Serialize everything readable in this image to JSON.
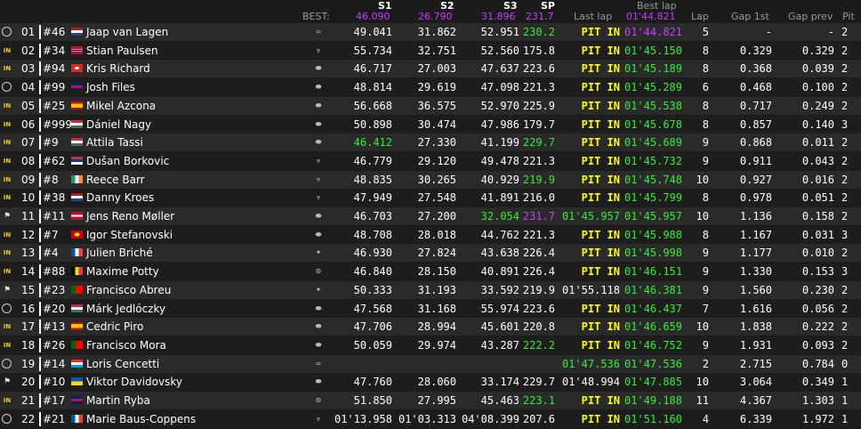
{
  "header": {
    "best_label": "BEST:",
    "col_s1": "S1",
    "col_s2": "S2",
    "col_s3": "S3",
    "col_sp": "SP",
    "col_last_lap": "Last lap",
    "col_best_lap": "Best lap",
    "col_lap": "Lap",
    "col_gap_1st": "Gap 1st",
    "col_gap_prev": "Gap prev",
    "col_pit": "Pit",
    "best_s1": "46.090",
    "best_s2": "26.790",
    "best_s3": "31.896",
    "best_sp": "231.7",
    "best_lap": "01'44.821"
  },
  "colors": {
    "personal_best": "#33ee33",
    "overall_best": "#c83cff",
    "pit": "#ffff00"
  },
  "rows": [
    {
      "status": "track",
      "pos": "01",
      "num": "#46",
      "flag": "nl",
      "name": "Jaap van Lagen",
      "brand": "audi",
      "s1": "49.041",
      "s2": "31.862",
      "s3": "52.951",
      "sp": "230.2",
      "last": "PIT IN",
      "best": "01'44.821",
      "lap": "5",
      "gap1": "-",
      "gapp": "-",
      "pit": "2",
      "c_s1": "",
      "c_s2": "",
      "c_s3": "",
      "c_sp": "green",
      "c_last": "yellow",
      "c_best": "purple"
    },
    {
      "status": "in",
      "pos": "02",
      "num": "#34",
      "flag": "no",
      "name": "Stian Paulsen",
      "brand": "cupra",
      "s1": "55.734",
      "s2": "32.751",
      "s3": "52.560",
      "sp": "175.8",
      "last": "PIT IN",
      "best": "01'45.150",
      "lap": "8",
      "gap1": "0.329",
      "gapp": "0.329",
      "pit": "2",
      "c_s1": "",
      "c_s2": "",
      "c_s3": "",
      "c_sp": "",
      "c_last": "yellow",
      "c_best": "green"
    },
    {
      "status": "in",
      "pos": "03",
      "num": "#94",
      "flag": "ch",
      "name": "Kris Richard",
      "brand": "hyundai",
      "s1": "46.717",
      "s2": "27.003",
      "s3": "47.637",
      "sp": "223.6",
      "last": "PIT IN",
      "best": "01'45.189",
      "lap": "8",
      "gap1": "0.368",
      "gapp": "0.039",
      "pit": "2",
      "c_s1": "",
      "c_s2": "",
      "c_s3": "",
      "c_sp": "",
      "c_last": "yellow",
      "c_best": "green"
    },
    {
      "status": "track",
      "pos": "04",
      "num": "#99",
      "flag": "gb",
      "name": "Josh Files",
      "brand": "hyundai",
      "s1": "48.814",
      "s2": "29.619",
      "s3": "47.098",
      "sp": "221.3",
      "last": "PIT IN",
      "best": "01'45.289",
      "lap": "6",
      "gap1": "0.468",
      "gapp": "0.100",
      "pit": "2",
      "c_s1": "",
      "c_s2": "",
      "c_s3": "",
      "c_sp": "",
      "c_last": "yellow",
      "c_best": "green"
    },
    {
      "status": "in",
      "pos": "05",
      "num": "#25",
      "flag": "es",
      "name": "Mikel Azcona",
      "brand": "hyundai",
      "s1": "56.668",
      "s2": "36.575",
      "s3": "52.970",
      "sp": "225.9",
      "last": "PIT IN",
      "best": "01'45.538",
      "lap": "8",
      "gap1": "0.717",
      "gapp": "0.249",
      "pit": "2",
      "c_s1": "",
      "c_s2": "",
      "c_s3": "",
      "c_sp": "",
      "c_last": "yellow",
      "c_best": "green"
    },
    {
      "status": "in",
      "pos": "06",
      "num": "#999",
      "flag": "hu",
      "name": "Dániel Nagy",
      "brand": "hyundai",
      "s1": "50.898",
      "s2": "30.474",
      "s3": "47.986",
      "sp": "179.7",
      "last": "PIT IN",
      "best": "01'45.678",
      "lap": "8",
      "gap1": "0.857",
      "gapp": "0.140",
      "pit": "3",
      "c_s1": "",
      "c_s2": "",
      "c_s3": "",
      "c_sp": "",
      "c_last": "yellow",
      "c_best": "green"
    },
    {
      "status": "in",
      "pos": "07",
      "num": "#9",
      "flag": "hu",
      "name": "Attila Tassi",
      "brand": "hyundai",
      "s1": "46.412",
      "s2": "27.330",
      "s3": "41.199",
      "sp": "229.7",
      "last": "PIT IN",
      "best": "01'45.689",
      "lap": "9",
      "gap1": "0.868",
      "gapp": "0.011",
      "pit": "2",
      "c_s1": "green",
      "c_s2": "",
      "c_s3": "",
      "c_sp": "green",
      "c_last": "yellow",
      "c_best": "green"
    },
    {
      "status": "in",
      "pos": "08",
      "num": "#62",
      "flag": "rs",
      "name": "Dušan Borkovic",
      "brand": "cupra",
      "s1": "46.779",
      "s2": "29.120",
      "s3": "49.478",
      "sp": "221.3",
      "last": "PIT IN",
      "best": "01'45.732",
      "lap": "9",
      "gap1": "0.911",
      "gapp": "0.043",
      "pit": "2",
      "c_s1": "",
      "c_s2": "",
      "c_s3": "",
      "c_sp": "",
      "c_last": "yellow",
      "c_best": "green"
    },
    {
      "status": "in",
      "pos": "09",
      "num": "#8",
      "flag": "ie",
      "name": "Reece Barr",
      "brand": "cupra",
      "s1": "48.835",
      "s2": "30.265",
      "s3": "40.929",
      "sp": "219.9",
      "last": "PIT IN",
      "best": "01'45.748",
      "lap": "10",
      "gap1": "0.927",
      "gapp": "0.016",
      "pit": "2",
      "c_s1": "",
      "c_s2": "",
      "c_s3": "",
      "c_sp": "green",
      "c_last": "yellow",
      "c_best": "green"
    },
    {
      "status": "in",
      "pos": "10",
      "num": "#38",
      "flag": "nl",
      "name": "Danny Kroes",
      "brand": "cupra",
      "s1": "47.949",
      "s2": "27.548",
      "s3": "41.891",
      "sp": "216.0",
      "last": "PIT IN",
      "best": "01'45.799",
      "lap": "8",
      "gap1": "0.978",
      "gapp": "0.051",
      "pit": "2",
      "c_s1": "",
      "c_s2": "",
      "c_s3": "",
      "c_sp": "",
      "c_last": "yellow",
      "c_best": "green"
    },
    {
      "status": "flag",
      "pos": "11",
      "num": "#11",
      "flag": "dk",
      "name": "Jens Reno Møller",
      "brand": "hyundai",
      "s1": "46.703",
      "s2": "27.200",
      "s3": "32.054",
      "sp": "231.7",
      "last": "01'45.957",
      "best": "01'45.957",
      "lap": "10",
      "gap1": "1.136",
      "gapp": "0.158",
      "pit": "2",
      "c_s1": "",
      "c_s2": "",
      "c_s3": "green",
      "c_sp": "purple",
      "c_last": "green",
      "c_best": "green"
    },
    {
      "status": "in",
      "pos": "12",
      "num": "#7",
      "flag": "mk",
      "name": "Igor Stefanovski",
      "brand": "hyundai",
      "s1": "48.708",
      "s2": "28.018",
      "s3": "44.762",
      "sp": "221.3",
      "last": "PIT IN",
      "best": "01'45.988",
      "lap": "8",
      "gap1": "1.167",
      "gapp": "0.031",
      "pit": "3",
      "c_s1": "",
      "c_s2": "",
      "c_s3": "",
      "c_sp": "",
      "c_last": "yellow",
      "c_best": "green"
    },
    {
      "status": "in",
      "pos": "13",
      "num": "#4",
      "flag": "fr",
      "name": "Julien Briché",
      "brand": "alfa",
      "s1": "46.930",
      "s2": "27.824",
      "s3": "43.638",
      "sp": "226.4",
      "last": "PIT IN",
      "best": "01'45.998",
      "lap": "9",
      "gap1": "1.177",
      "gapp": "0.010",
      "pit": "2",
      "c_s1": "",
      "c_s2": "",
      "c_s3": "",
      "c_sp": "",
      "c_last": "yellow",
      "c_best": "green"
    },
    {
      "status": "in",
      "pos": "14",
      "num": "#88",
      "flag": "be",
      "name": "Maxime Potty",
      "brand": "vw",
      "s1": "46.840",
      "s2": "28.150",
      "s3": "40.891",
      "sp": "226.4",
      "last": "PIT IN",
      "best": "01'46.151",
      "lap": "9",
      "gap1": "1.330",
      "gapp": "0.153",
      "pit": "3",
      "c_s1": "",
      "c_s2": "",
      "c_s3": "",
      "c_sp": "",
      "c_last": "yellow",
      "c_best": "green"
    },
    {
      "status": "flag",
      "pos": "15",
      "num": "#23",
      "flag": "pt",
      "name": "Francisco Abreu",
      "brand": "alfa",
      "s1": "50.333",
      "s2": "31.193",
      "s3": "33.592",
      "sp": "219.9",
      "last": "01'55.118",
      "best": "01'46.381",
      "lap": "9",
      "gap1": "1.560",
      "gapp": "0.230",
      "pit": "2",
      "c_s1": "",
      "c_s2": "",
      "c_s3": "",
      "c_sp": "",
      "c_last": "",
      "c_best": "green"
    },
    {
      "status": "track",
      "pos": "16",
      "num": "#20",
      "flag": "hu",
      "name": "Márk Jedlóczky",
      "brand": "hyundai",
      "s1": "47.568",
      "s2": "31.168",
      "s3": "55.974",
      "sp": "223.6",
      "last": "PIT IN",
      "best": "01'46.437",
      "lap": "7",
      "gap1": "1.616",
      "gapp": "0.056",
      "pit": "2",
      "c_s1": "",
      "c_s2": "",
      "c_s3": "",
      "c_sp": "",
      "c_last": "yellow",
      "c_best": "green"
    },
    {
      "status": "in",
      "pos": "17",
      "num": "#13",
      "flag": "es",
      "name": "Cedric Piro",
      "brand": "hyundai",
      "s1": "47.706",
      "s2": "28.994",
      "s3": "45.601",
      "sp": "220.8",
      "last": "PIT IN",
      "best": "01'46.659",
      "lap": "10",
      "gap1": "1.838",
      "gapp": "0.222",
      "pit": "2",
      "c_s1": "",
      "c_s2": "",
      "c_s3": "",
      "c_sp": "",
      "c_last": "yellow",
      "c_best": "green"
    },
    {
      "status": "in",
      "pos": "18",
      "num": "#26",
      "flag": "pt",
      "name": "Francisco Mora",
      "brand": "hyundai",
      "s1": "50.059",
      "s2": "29.974",
      "s3": "43.287",
      "sp": "222.2",
      "last": "PIT IN",
      "best": "01'46.752",
      "lap": "9",
      "gap1": "1.931",
      "gapp": "0.093",
      "pit": "2",
      "c_s1": "",
      "c_s2": "",
      "c_s3": "",
      "c_sp": "green",
      "c_last": "yellow",
      "c_best": "green"
    },
    {
      "status": "track",
      "pos": "19",
      "num": "#14",
      "flag": "lu",
      "name": "Loris Cencetti",
      "brand": "audi",
      "s1": "",
      "s2": "",
      "s3": "",
      "sp": "",
      "last": "01'47.536",
      "best": "01'47.536",
      "lap": "2",
      "gap1": "2.715",
      "gapp": "0.784",
      "pit": "0",
      "c_s1": "",
      "c_s2": "",
      "c_s3": "",
      "c_sp": "",
      "c_last": "green",
      "c_best": "green"
    },
    {
      "status": "flag",
      "pos": "20",
      "num": "#10",
      "flag": "ua",
      "name": "Viktor Davidovsky",
      "brand": "hyundai",
      "s1": "47.760",
      "s2": "28.060",
      "s3": "33.174",
      "sp": "229.7",
      "last": "01'48.994",
      "best": "01'47.885",
      "lap": "10",
      "gap1": "3.064",
      "gapp": "0.349",
      "pit": "1",
      "c_s1": "",
      "c_s2": "",
      "c_s3": "",
      "c_sp": "",
      "c_last": "",
      "c_best": "green"
    },
    {
      "status": "in",
      "pos": "21",
      "num": "#17",
      "flag": "gb",
      "name": "Martin Ryba",
      "brand": "vw",
      "s1": "51.850",
      "s2": "27.995",
      "s3": "45.463",
      "sp": "223.1",
      "last": "PIT IN",
      "best": "01'49.188",
      "lap": "11",
      "gap1": "4.367",
      "gapp": "1.303",
      "pit": "1",
      "c_s1": "",
      "c_s2": "",
      "c_s3": "",
      "c_sp": "green",
      "c_last": "yellow",
      "c_best": "green"
    },
    {
      "status": "track",
      "pos": "22",
      "num": "#21",
      "flag": "fr",
      "name": "Marie Baus-Coppens",
      "brand": "cupra",
      "s1": "01'13.958",
      "s2": "01'03.313",
      "s3": "04'08.399",
      "sp": "207.6",
      "last": "PIT IN",
      "best": "01'51.160",
      "lap": "4",
      "gap1": "6.339",
      "gapp": "1.972",
      "pit": "1",
      "c_s1": "",
      "c_s2": "",
      "c_s3": "",
      "c_sp": "",
      "c_last": "yellow",
      "c_best": "green"
    }
  ]
}
